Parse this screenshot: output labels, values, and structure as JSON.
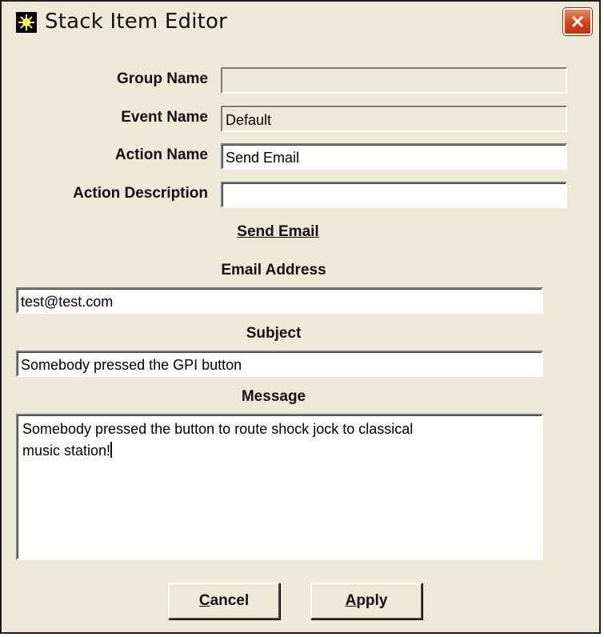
{
  "window": {
    "title": "Stack Item Editor",
    "app_icon": "sun-burst-icon",
    "close_icon": "close-icon"
  },
  "form": {
    "group_name_label": "Group Name",
    "group_name_value": "",
    "event_name_label": "Event Name",
    "event_name_value": "Default",
    "action_name_label": "Action Name",
    "action_name_value": "Send Email",
    "action_description_label": "Action Description",
    "action_description_value": ""
  },
  "email": {
    "section_title": "Send Email",
    "address_label": "Email Address",
    "address_value": "test@test.com",
    "subject_label": "Subject",
    "subject_value": "Somebody pressed the GPI button",
    "message_label": "Message",
    "message_line1": "Somebody pressed the button to route shock jock to classical",
    "message_line2": "music station!"
  },
  "buttons": {
    "cancel_mnemonic": "C",
    "cancel_rest": "ancel",
    "apply_mnemonic": "A",
    "apply_rest": "pply"
  },
  "colors": {
    "window_bg": "#ece9d8",
    "close_button": "#d1421c"
  }
}
